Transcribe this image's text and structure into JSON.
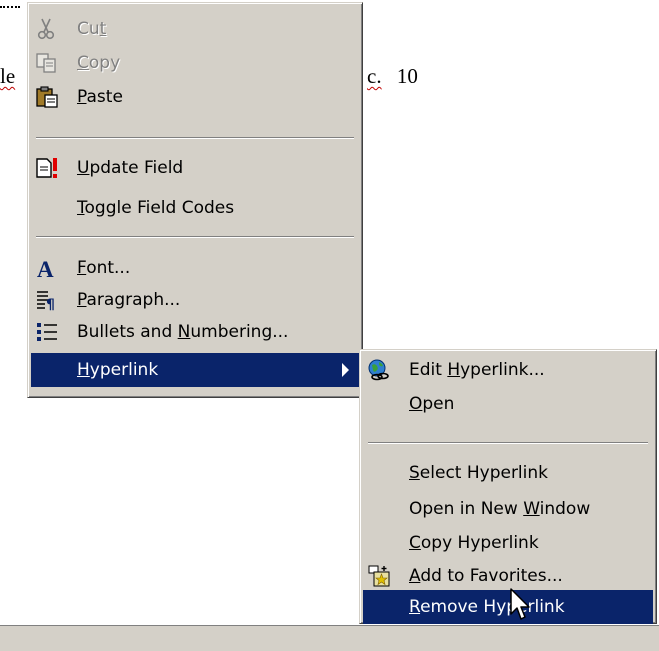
{
  "document": {
    "fragment_left": "le",
    "fragment_right": "c.",
    "number": "10"
  },
  "context_menu": {
    "items": [
      {
        "label": "Cut",
        "mnemonic": "t",
        "icon": "scissors-icon",
        "disabled": true
      },
      {
        "label": "Copy",
        "mnemonic": "C",
        "icon": "copy-icon",
        "disabled": true
      },
      {
        "label": "Paste",
        "mnemonic": "P",
        "icon": "paste-icon",
        "disabled": false
      },
      {
        "label": "Update Field",
        "mnemonic": "U",
        "icon": "update-field-icon",
        "disabled": false
      },
      {
        "label": "Toggle Field Codes",
        "mnemonic": "T",
        "disabled": false
      },
      {
        "label": "Font...",
        "mnemonic": "F",
        "icon": "font-icon",
        "disabled": false
      },
      {
        "label": "Paragraph...",
        "mnemonic": "P",
        "icon": "paragraph-icon",
        "disabled": false
      },
      {
        "label": "Bullets and Numbering...",
        "mnemonic": "N",
        "icon": "bullets-icon",
        "disabled": false
      },
      {
        "label": "Hyperlink",
        "mnemonic": "H",
        "has_submenu": true,
        "highlighted": true
      }
    ]
  },
  "hyperlink_submenu": {
    "items": [
      {
        "label": "Edit Hyperlink...",
        "mnemonic": "H",
        "icon": "globe-link-icon"
      },
      {
        "label": "Open",
        "mnemonic": "O"
      },
      {
        "label": "Select Hyperlink",
        "mnemonic": "S"
      },
      {
        "label": "Open in New Window",
        "mnemonic": "W"
      },
      {
        "label": "Copy Hyperlink",
        "mnemonic": "C"
      },
      {
        "label": "Add to Favorites...",
        "mnemonic": "A",
        "icon": "favorites-icon"
      },
      {
        "label": "Remove Hyperlink",
        "mnemonic": "R",
        "highlighted": true
      }
    ]
  },
  "colors": {
    "menu_bg": "#d4d0c8",
    "highlight": "#0a246a",
    "disabled_text": "#808080"
  }
}
